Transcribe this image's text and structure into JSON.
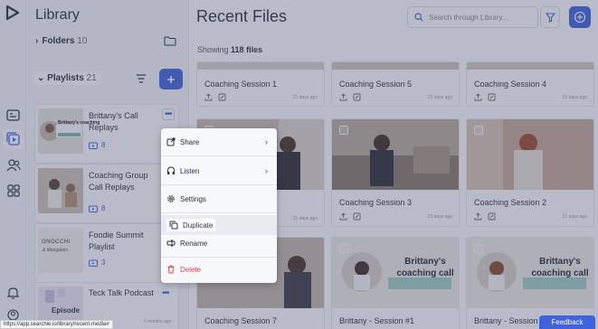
{
  "library": {
    "title": "Library",
    "folders_label": "Folders",
    "folders_count": "10",
    "playlists_label": "Playlists",
    "playlists_count": "21",
    "playlists": [
      {
        "name": "Brittany's Call Replays",
        "count": "8",
        "thumb_text": "Brittany's coaching"
      },
      {
        "name": "Coaching Group Call Replays",
        "count": "8"
      },
      {
        "name": "Foodie Summit Playlist",
        "count": "3",
        "thumb_text": "GNOCCHI"
      },
      {
        "name": "Teck Talk Podcast",
        "count": "",
        "thumb_text": "Episode",
        "ago": "5 months ago"
      }
    ]
  },
  "main": {
    "title": "Recent Files",
    "search_placeholder": "Search through Library...",
    "showing_prefix": "Showing",
    "showing_count": "118 files",
    "files": [
      {
        "title": "Coaching Session 1",
        "ago": "21 days ago"
      },
      {
        "title": "Coaching Session 5",
        "ago": "21 days ago"
      },
      {
        "title": "Coaching Session 4",
        "ago": "21 days ago"
      },
      {
        "title": "",
        "ago": "21 days ago"
      },
      {
        "title": "Coaching Session 3",
        "ago": "21 days ago"
      },
      {
        "title": "Coaching Session 2",
        "ago": "21 days ago"
      },
      {
        "title": "Coaching Session 7",
        "thumb_text": ""
      },
      {
        "title": "Brittany - Session #1",
        "thumb_text": "Brittany's coaching call"
      },
      {
        "title": "Brittany - Session #",
        "thumb_text": "Brittany's coaching call"
      }
    ]
  },
  "context_menu": {
    "share": "Share",
    "listen": "Listen",
    "settings": "Settings",
    "duplicate": "Duplicate",
    "rename": "Rename",
    "delete": "Delete"
  },
  "status_url": "https://app.searchie.io/library/recent-media#",
  "feedback_label": "Feedback",
  "colors": {
    "accent": "#3e63dd",
    "danger": "#e5484d",
    "overlay": "rgba(70,80,110,0.38)"
  }
}
